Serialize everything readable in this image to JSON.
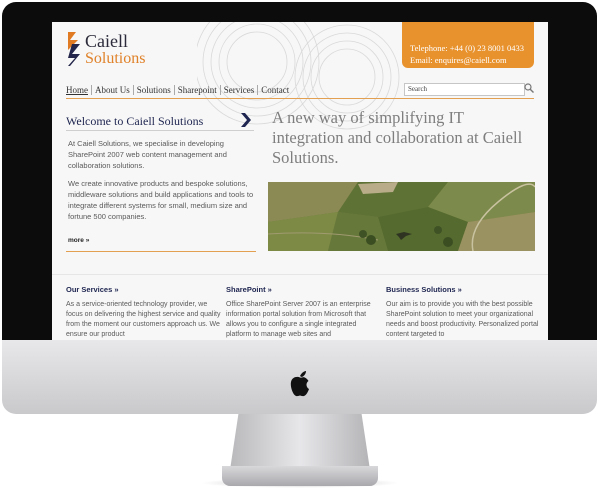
{
  "site": {
    "brand": {
      "name": "Caiell",
      "sub": "Solutions"
    },
    "contact": {
      "telephone": "Telephone: +44 (0) 23 8001 0433",
      "email": "Email: enquires@caiell.com"
    },
    "nav": [
      "Home",
      "About Us",
      "Solutions",
      "Sharepoint",
      "Services",
      "Contact"
    ],
    "search": {
      "placeholder": "Search"
    },
    "welcome": {
      "title": "Welcome to Caiell Solutions",
      "p1": "At Caiell Solutions, we specialise in developing SharePoint 2007 web content management and collaboration solutions.",
      "p2": "We create innovative products and bespoke solutions, middleware solutions and build applications and tools to integrate different systems for small, medium size and fortune 500 companies.",
      "more": "more »"
    },
    "tagline": "A new way of simplifying IT integration and collaboration at Caiell Solutions.",
    "columns": [
      {
        "title": "Our Services »",
        "text": "As a service-oriented technology provider, we focus on delivering the highest service and quality from the moment our customers approach us. We ensure our product"
      },
      {
        "title": "SharePoint »",
        "text": "Office SharePoint Server 2007 is an enterprise information portal solution from Microsoft that allows you to configure a single integrated platform to manage web sites and"
      },
      {
        "title": "Business Solutions »",
        "text": "Our aim is to provide you with the best possible SharePoint solution to meet your organizational needs and boost productivity. Personalized portal content targeted to"
      }
    ]
  },
  "icons": {
    "device_logo": "apple-logo-icon",
    "search": "magnifier-icon",
    "arrow": "chevron-right-icon"
  },
  "colors": {
    "accent": "#e8922e",
    "navy": "#1e2550",
    "bezel": "#0c0c0c"
  }
}
